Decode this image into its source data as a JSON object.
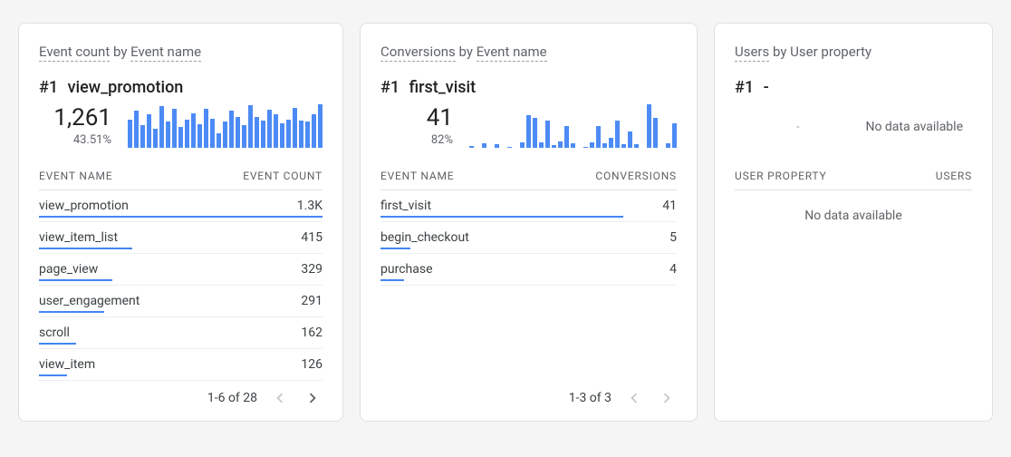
{
  "cards": [
    {
      "title_metric": "Event count",
      "title_by": "by",
      "title_dim": "Event name",
      "rank_prefix": "#1",
      "rank_name": "view_promotion",
      "metric_value": "1,261",
      "metric_pct": "43.51%",
      "col1": "EVENT NAME",
      "col2": "EVENT COUNT",
      "rows": [
        {
          "name": "view_promotion",
          "value": "1.3K",
          "bar": 100
        },
        {
          "name": "view_item_list",
          "value": "415",
          "bar": 33
        },
        {
          "name": "page_view",
          "value": "329",
          "bar": 26
        },
        {
          "name": "user_engagement",
          "value": "291",
          "bar": 23
        },
        {
          "name": "scroll",
          "value": "162",
          "bar": 13
        },
        {
          "name": "view_item",
          "value": "126",
          "bar": 10
        }
      ],
      "pager": "1-6 of 28",
      "prev_enabled": false,
      "next_enabled": true,
      "spark": [
        60,
        78,
        48,
        70,
        40,
        88,
        55,
        82,
        45,
        60,
        72,
        50,
        82,
        62,
        30,
        55,
        78,
        65,
        48,
        90,
        66,
        58,
        80,
        70,
        52,
        60,
        85,
        58,
        55,
        70,
        92
      ],
      "chart_data": {
        "type": "bar",
        "title": "Event count by Event name — top event over time",
        "series": [
          {
            "name": "view_promotion",
            "values": [
              60,
              78,
              48,
              70,
              40,
              88,
              55,
              82,
              45,
              60,
              72,
              50,
              82,
              62,
              30,
              55,
              78,
              65,
              48,
              90,
              66,
              58,
              80,
              70,
              52,
              60,
              85,
              58,
              55,
              70,
              92
            ]
          }
        ],
        "ylim": [
          0,
          100
        ]
      }
    },
    {
      "title_metric": "Conversions",
      "title_by": "by",
      "title_dim": "Event name",
      "rank_prefix": "#1",
      "rank_name": "first_visit",
      "metric_value": "41",
      "metric_pct": "82%",
      "col1": "EVENT NAME",
      "col2": "CONVERSIONS",
      "rows": [
        {
          "name": "first_visit",
          "value": "41",
          "bar": 82
        },
        {
          "name": "begin_checkout",
          "value": "5",
          "bar": 10
        },
        {
          "name": "purchase",
          "value": "4",
          "bar": 8
        }
      ],
      "pager": "1-3 of 3",
      "prev_enabled": false,
      "next_enabled": false,
      "spark": [
        4,
        0,
        8,
        0,
        6,
        0,
        2,
        0,
        10,
        60,
        55,
        10,
        50,
        5,
        12,
        40,
        8,
        0,
        2,
        10,
        40,
        8,
        18,
        50,
        6,
        30,
        6,
        0,
        80,
        55,
        0,
        8,
        45
      ],
      "chart_data": {
        "type": "bar",
        "title": "Conversions by Event name — top event over time",
        "series": [
          {
            "name": "first_visit",
            "values": [
              4,
              0,
              8,
              0,
              6,
              0,
              2,
              0,
              10,
              60,
              55,
              10,
              50,
              5,
              12,
              40,
              8,
              0,
              2,
              10,
              40,
              8,
              18,
              50,
              6,
              30,
              6,
              0,
              80,
              55,
              0,
              8,
              45
            ]
          }
        ],
        "ylim": [
          0,
          100
        ]
      }
    },
    {
      "title_metric": "Users",
      "title_by": "by",
      "title_dim": "User property",
      "title_dim_dotted": false,
      "rank_prefix": "#1",
      "rank_name": "-",
      "no_data_chart_dash": "-",
      "no_data_chart": "No data available",
      "col1": "USER PROPERTY",
      "col2": "USERS",
      "no_data_body": "No data available"
    }
  ]
}
